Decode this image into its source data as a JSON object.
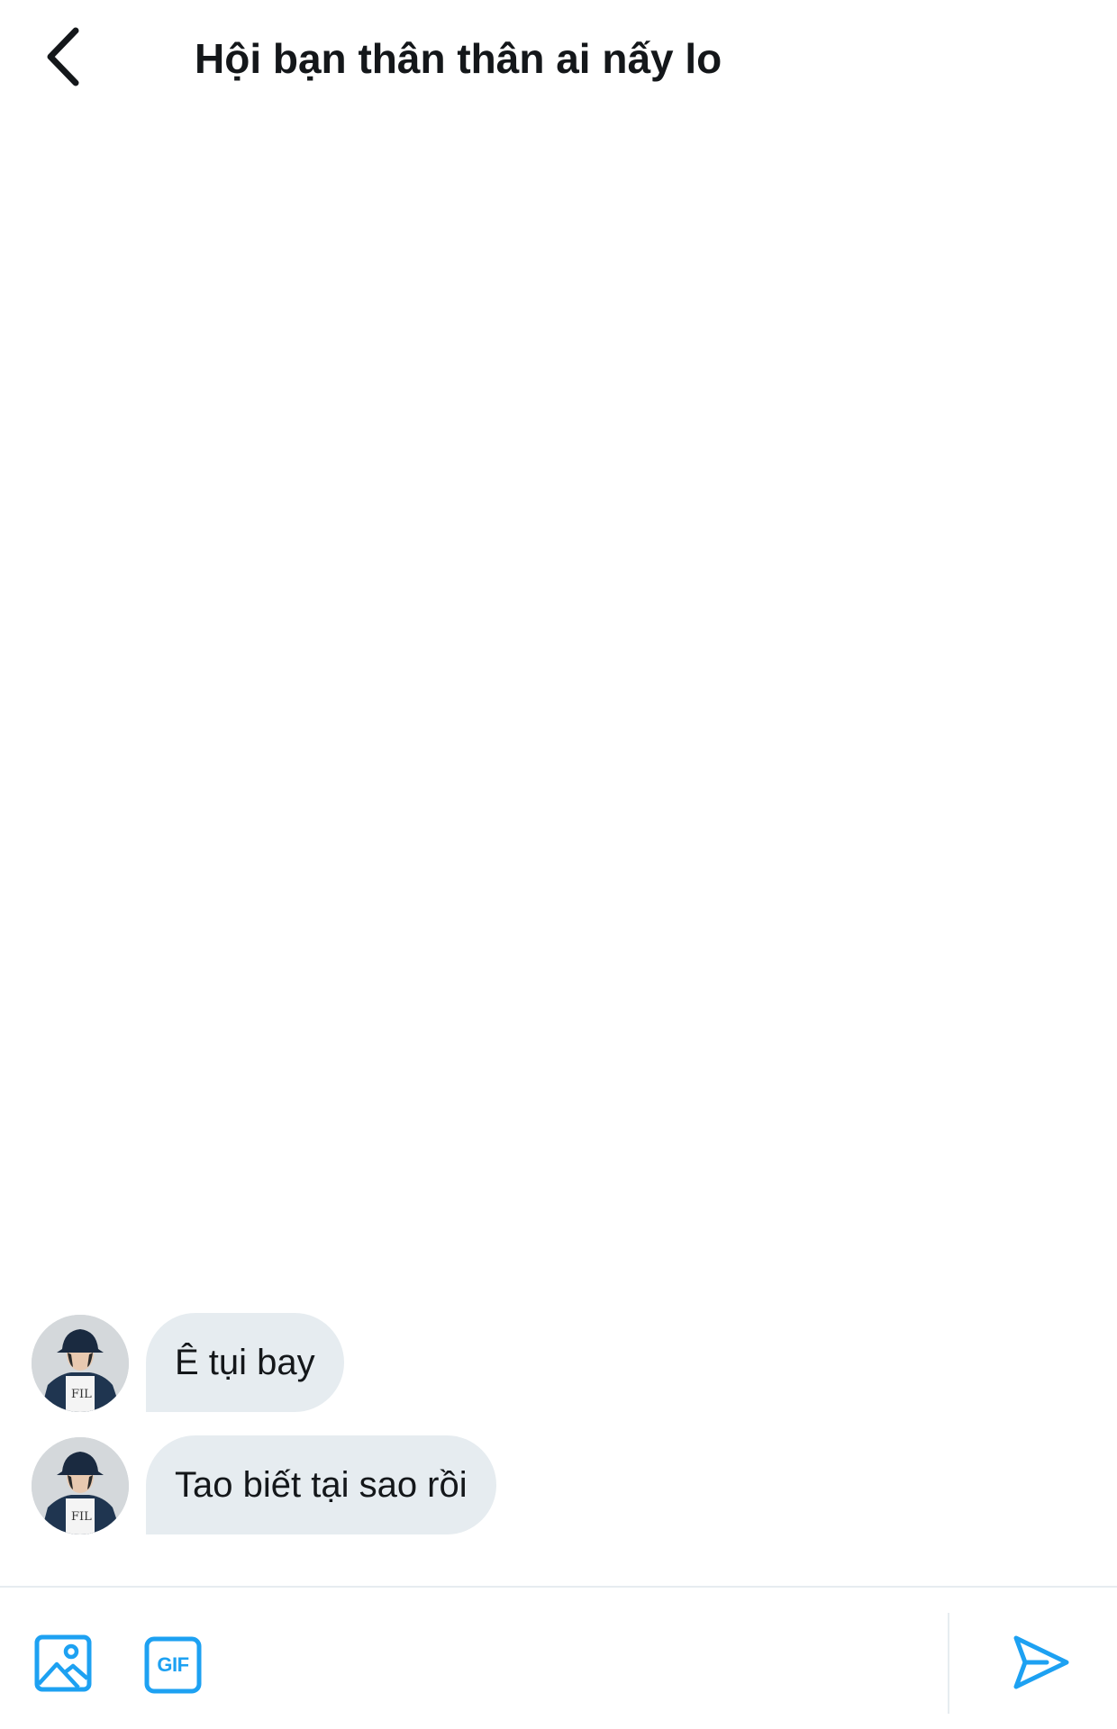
{
  "header": {
    "title": "Hội bạn thân thân ai nấy lo",
    "back_icon": "chevron-left-icon"
  },
  "messages": [
    {
      "text": "Ê tụi bay",
      "avatar": "user-avatar"
    },
    {
      "text": "Tao biết tại sao rồi",
      "avatar": "user-avatar"
    }
  ],
  "composer": {
    "image_icon": "image-icon",
    "gif_label": "GIF",
    "send_icon": "send-icon"
  },
  "colors": {
    "accent": "#1da1f2",
    "bubble": "#e6ecf0",
    "text": "#14171a"
  }
}
